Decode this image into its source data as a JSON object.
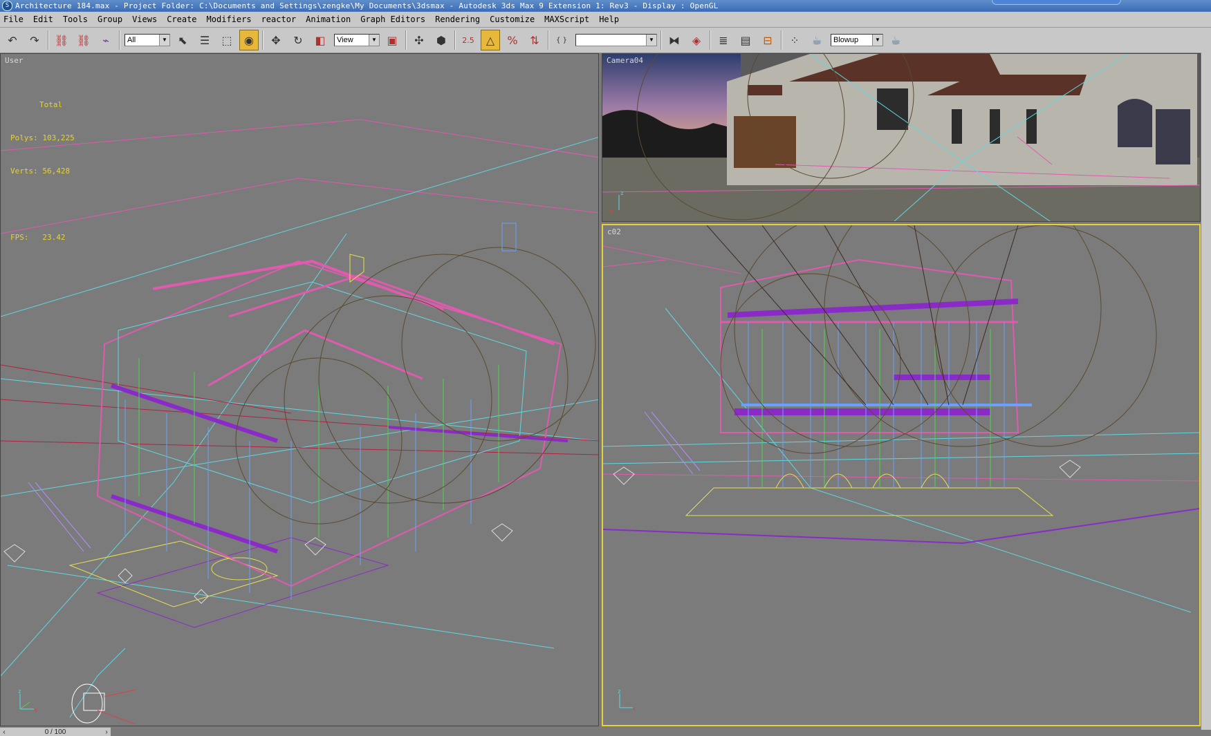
{
  "window": {
    "title": "Architecture 184.max      - Project Folder: C:\\Documents and Settings\\zengke\\My Documents\\3dsmax       - Autodesk 3ds Max 9 Extension 1: Rev3        - Display : OpenGL",
    "icon": "3ds-max-logo-icon"
  },
  "menu": [
    "File",
    "Edit",
    "Tools",
    "Group",
    "Views",
    "Create",
    "Modifiers",
    "reactor",
    "Animation",
    "Graph Editors",
    "Rendering",
    "Customize",
    "MAXScript",
    "Help"
  ],
  "toolbar": {
    "selection_filter": "All",
    "reference_coord": "View",
    "named_selection": "",
    "render_type": "Blowup",
    "snap_angle_label": "2.5",
    "active_tool": "angle-snap-toggle"
  },
  "viewports": {
    "user": {
      "label": "User",
      "stats": {
        "header": "Total",
        "polys_label": "Polys:",
        "polys": "103,225",
        "verts_label": "Verts:",
        "verts": "56,428",
        "fps_label": "FPS:",
        "fps": "23.42"
      }
    },
    "camera": {
      "label": "Camera04"
    },
    "c02": {
      "label": "c02",
      "active": true
    }
  },
  "timeline": {
    "position": "0 / 100"
  },
  "colors": {
    "viewport_bg": "#7b7b7b",
    "active_border": "#e6d232",
    "ui_gray": "#c8c8c8",
    "wire_pink": "#e05ab0",
    "wire_cyan": "#5fd8e0",
    "wire_purple": "#8a2bc8",
    "wire_green": "#4ad84a",
    "wire_yellow": "#e8e050",
    "wire_orbit": "#5a4a30"
  }
}
